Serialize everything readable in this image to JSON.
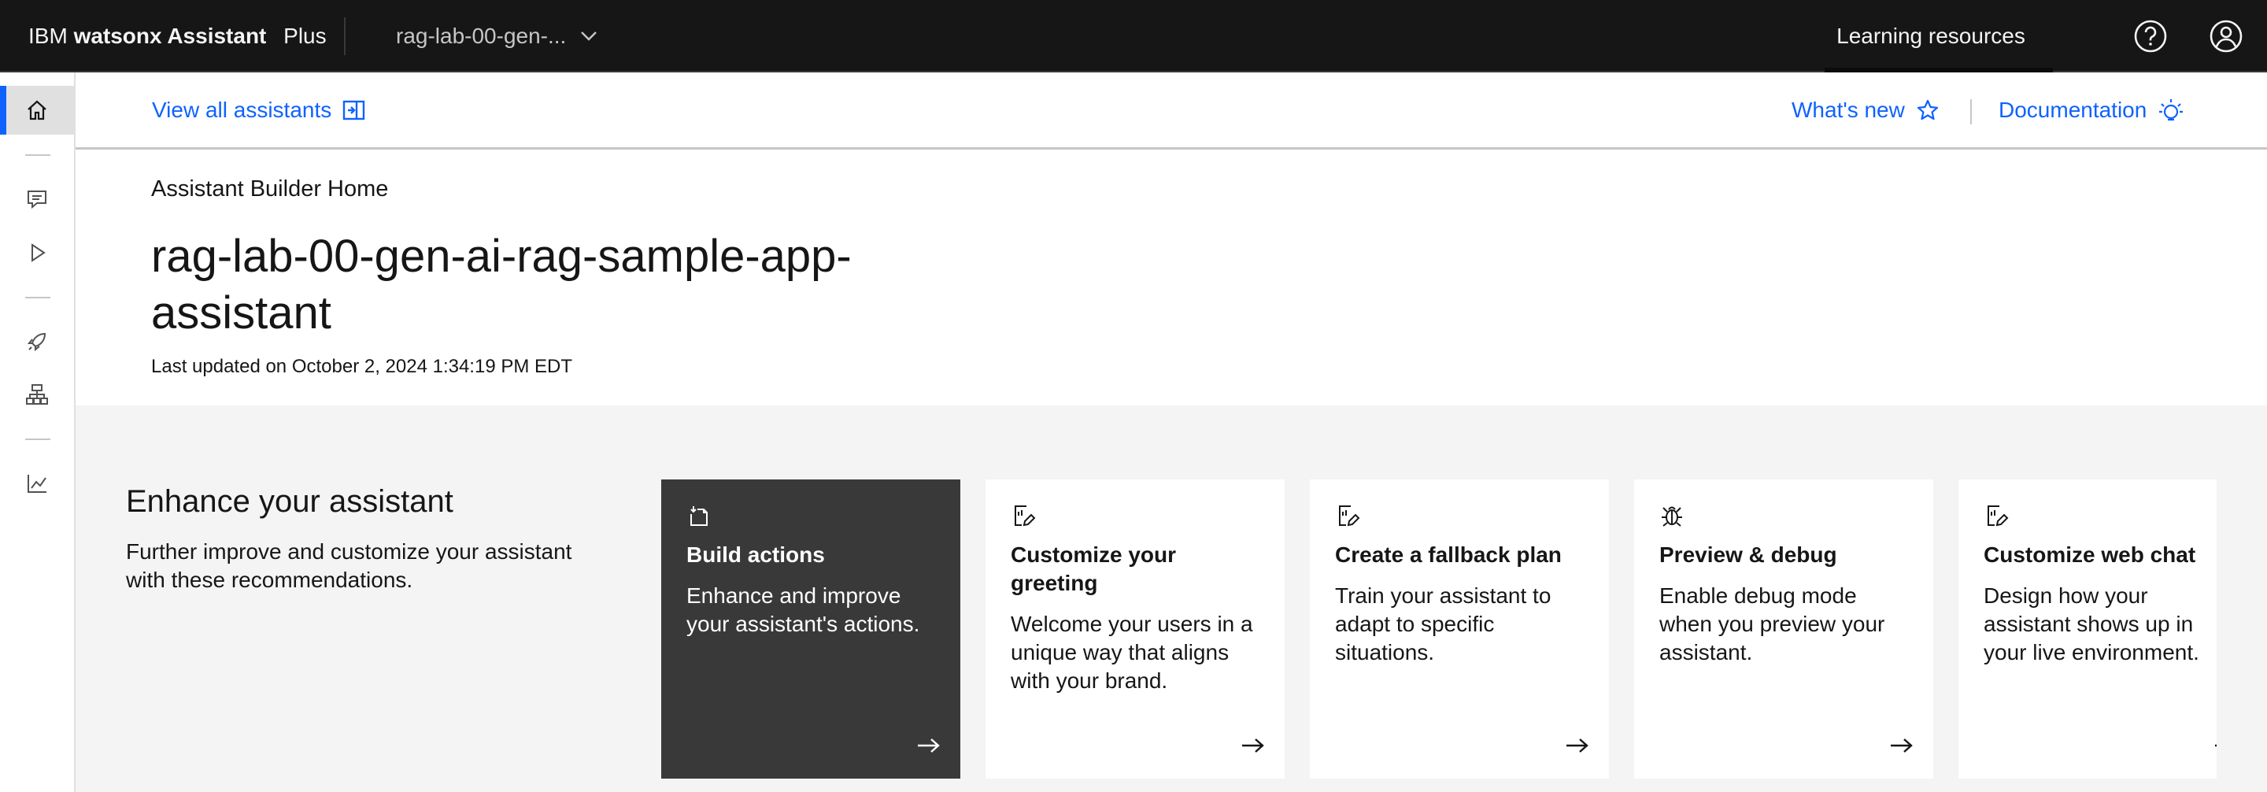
{
  "header": {
    "brand_prefix": "IBM",
    "brand_name": "watsonx Assistant",
    "plan": "Plus",
    "assistant_switcher": "rag-lab-00-gen-...",
    "learning_resources": "Learning resources",
    "help_icon": "help-icon",
    "user_icon": "user-avatar-icon"
  },
  "rail": {
    "items": [
      "home-icon",
      "chat-icon",
      "play-icon",
      "rocket-icon",
      "flow-icon",
      "analytics-icon"
    ],
    "active": "home-icon"
  },
  "subheader": {
    "view_all": "View all assistants",
    "whats_new": "What's new",
    "documentation": "Documentation"
  },
  "page": {
    "breadcrumb": "Assistant Builder Home",
    "title": "rag-lab-00-gen-ai-rag-sample-app-assistant",
    "last_updated": "Last updated on October 2, 2024 1:34:19 PM EDT"
  },
  "enhance": {
    "title": "Enhance your assistant",
    "description": "Further improve and customize your assistant with these recommendations.",
    "cards": [
      {
        "title": "Build actions",
        "description": "Enhance and improve your assistant's actions.",
        "icon": "build-actions-icon"
      },
      {
        "title": "Customize your greeting",
        "description": "Welcome your users in a unique way that aligns with your brand.",
        "icon": "edit-document-icon"
      },
      {
        "title": "Create a fallback plan",
        "description": "Train your assistant to adapt to specific situations.",
        "icon": "edit-document-icon"
      },
      {
        "title": "Preview & debug",
        "description": "Enable debug mode when you preview your assistant.",
        "icon": "debug-icon"
      },
      {
        "title": "Customize web chat",
        "description": "Design how your assistant shows up in your live environment.",
        "icon": "edit-document-icon"
      }
    ]
  },
  "colors": {
    "header_bg": "#161616",
    "link": "#0f62fe",
    "active_accent": "#0f62fe",
    "section_bg": "#f4f4f4",
    "selected_card": "#393939"
  }
}
